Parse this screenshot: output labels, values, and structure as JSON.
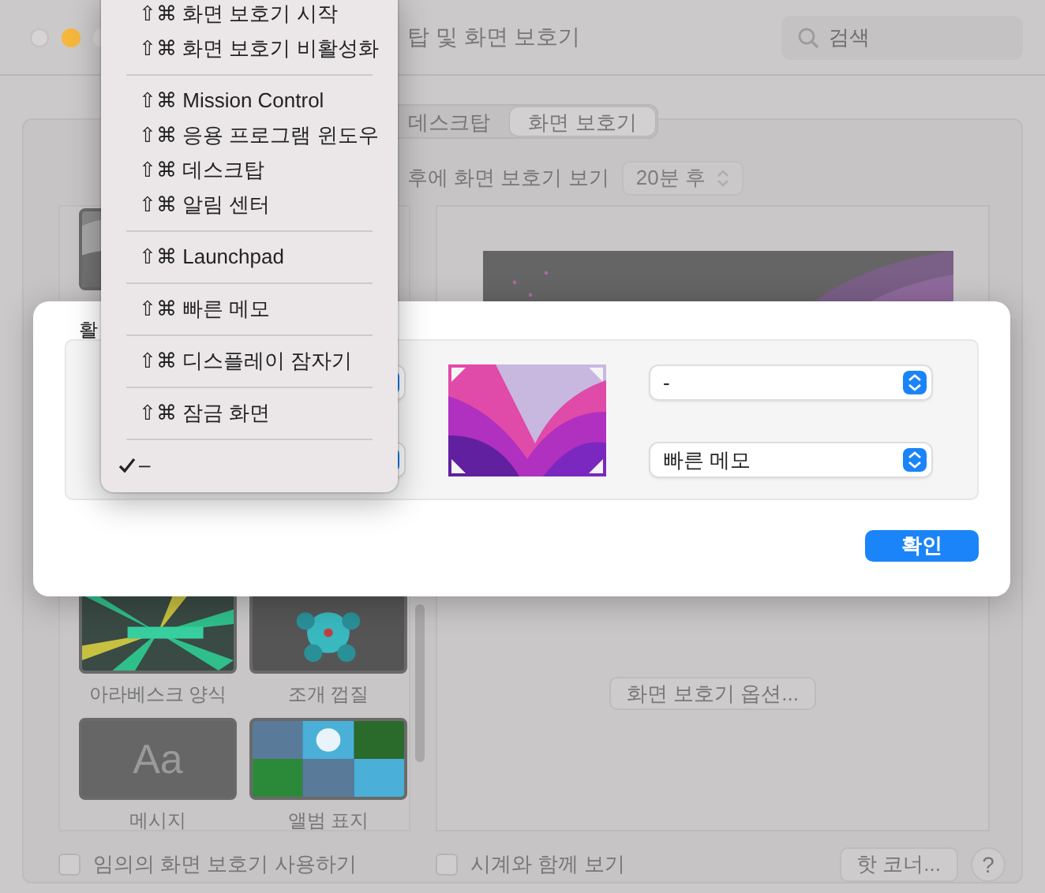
{
  "window": {
    "title": "탑 및 화면 보호기"
  },
  "search": {
    "placeholder": "검색"
  },
  "tabs": [
    {
      "label": "데스크탑",
      "selected": false
    },
    {
      "label": "화면 보호기",
      "selected": true
    }
  ],
  "idle": {
    "label": "후에 화면 보호기 보기",
    "value": "20분 후",
    "disabled": true
  },
  "screen_savers": [
    {
      "kind": "picture"
    },
    {
      "kind": "picture",
      "label": "아라베스크 양식"
    },
    {
      "kind": "picture",
      "label": "조개 껍질"
    },
    {
      "kind": "text",
      "text": "Aa",
      "label": "메시지"
    },
    {
      "kind": "picture",
      "label": "앨범 표지"
    }
  ],
  "preview": {
    "options_button": "화면 보호기 옵션..."
  },
  "random": {
    "label": "임의의 화면 보호기 사용하기",
    "checked": false
  },
  "clock": {
    "label": "시계와 함께 보기",
    "checked": false
  },
  "hot_corners_button": "핫 코너...",
  "help_button": "?",
  "sheet": {
    "title": "활",
    "right_corners": [
      {
        "value": "-"
      },
      {
        "value": "빠른 메모"
      }
    ],
    "ok_button": "확인"
  },
  "menu": {
    "groups": [
      {
        "items": [
          {
            "label": "⇧⌘ 화면 보호기 시작",
            "checked": false
          },
          {
            "label": "⇧⌘ 화면 보호기 비활성화",
            "checked": false
          }
        ]
      },
      {
        "items": [
          {
            "label": "⇧⌘ Mission Control",
            "checked": false
          },
          {
            "label": "⇧⌘ 응용 프로그램 윈도우",
            "checked": false
          },
          {
            "label": "⇧⌘ 데스크탑",
            "checked": false
          },
          {
            "label": "⇧⌘ 알림 센터",
            "checked": false
          }
        ]
      },
      {
        "items": [
          {
            "label": "⇧⌘ Launchpad",
            "checked": false
          }
        ]
      },
      {
        "items": [
          {
            "label": "⇧⌘ 빠른 메모",
            "checked": false
          }
        ]
      },
      {
        "items": [
          {
            "label": "⇧⌘ 디스플레이 잠자기",
            "checked": false
          }
        ]
      },
      {
        "items": [
          {
            "label": "⇧⌘ 잠금 화면",
            "checked": false
          }
        ]
      },
      {
        "items": [
          {
            "label": "–",
            "checked": true
          }
        ]
      }
    ]
  }
}
